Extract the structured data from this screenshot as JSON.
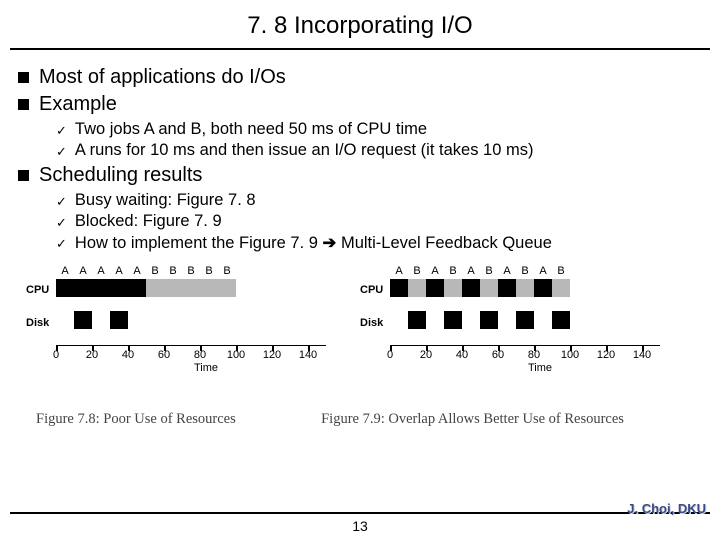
{
  "title": "7. 8 Incorporating I/O",
  "bullets": {
    "b1": "Most of applications do I/Os",
    "b2": "Example",
    "b2a": "Two jobs A and B, both need 50 ms of CPU time",
    "b2b": "A runs for 10 ms and then issue an I/O request (it takes 10 ms)",
    "b3": "Scheduling results",
    "b3a": "Busy waiting: Figure 7. 8",
    "b3b": "Blocked: Figure 7. 9",
    "b3c_pre": "How to implement the Figure 7. 9 ",
    "b3c_post": " Multi-Level Feedback Queue"
  },
  "fig78": {
    "caption": "Figure 7.8: Poor Use of Resources",
    "cpu": "CPU",
    "disk": "Disk",
    "time": "Time",
    "top": [
      "A",
      "A",
      "A",
      "A",
      "A",
      "B",
      "B",
      "B",
      "B",
      "B"
    ],
    "ticks": [
      "0",
      "20",
      "40",
      "60",
      "80",
      "100",
      "120",
      "140"
    ]
  },
  "fig79": {
    "caption": "Figure 7.9: Overlap Allows Better Use of Resources",
    "cpu": "CPU",
    "disk": "Disk",
    "time": "Time",
    "top": [
      "A",
      "B",
      "A",
      "B",
      "A",
      "B",
      "A",
      "B",
      "A",
      "B"
    ],
    "ticks": [
      "0",
      "20",
      "40",
      "60",
      "80",
      "100",
      "120",
      "140"
    ]
  },
  "page": "13",
  "author": "J. Choi, DKU",
  "chart_data": [
    {
      "type": "bar",
      "title": "Figure 7.8 Poor Use of Resources",
      "xlabel": "Time",
      "ylabel": "",
      "xlim": [
        0,
        140
      ],
      "series": [
        {
          "name": "CPU",
          "segments": [
            {
              "job": "A",
              "start": 0,
              "end": 50
            },
            {
              "job": "B",
              "start": 50,
              "end": 100
            }
          ]
        },
        {
          "name": "Disk",
          "segments": [
            {
              "job": "A",
              "start": 10,
              "end": 20
            },
            {
              "job": "A",
              "start": 30,
              "end": 40
            }
          ]
        }
      ]
    },
    {
      "type": "bar",
      "title": "Figure 7.9 Overlap Allows Better Use of Resources",
      "xlabel": "Time",
      "ylabel": "",
      "xlim": [
        0,
        140
      ],
      "series": [
        {
          "name": "CPU",
          "segments": [
            {
              "job": "A",
              "start": 0,
              "end": 10
            },
            {
              "job": "B",
              "start": 10,
              "end": 20
            },
            {
              "job": "A",
              "start": 20,
              "end": 30
            },
            {
              "job": "B",
              "start": 30,
              "end": 40
            },
            {
              "job": "A",
              "start": 40,
              "end": 50
            },
            {
              "job": "B",
              "start": 50,
              "end": 60
            },
            {
              "job": "A",
              "start": 60,
              "end": 70
            },
            {
              "job": "B",
              "start": 70,
              "end": 80
            },
            {
              "job": "A",
              "start": 80,
              "end": 90
            },
            {
              "job": "B",
              "start": 90,
              "end": 100
            }
          ]
        },
        {
          "name": "Disk",
          "segments": [
            {
              "job": "A",
              "start": 10,
              "end": 20
            },
            {
              "job": "A",
              "start": 30,
              "end": 40
            },
            {
              "job": "A",
              "start": 50,
              "end": 60
            },
            {
              "job": "A",
              "start": 70,
              "end": 80
            },
            {
              "job": "A",
              "start": 90,
              "end": 100
            }
          ]
        }
      ]
    }
  ]
}
